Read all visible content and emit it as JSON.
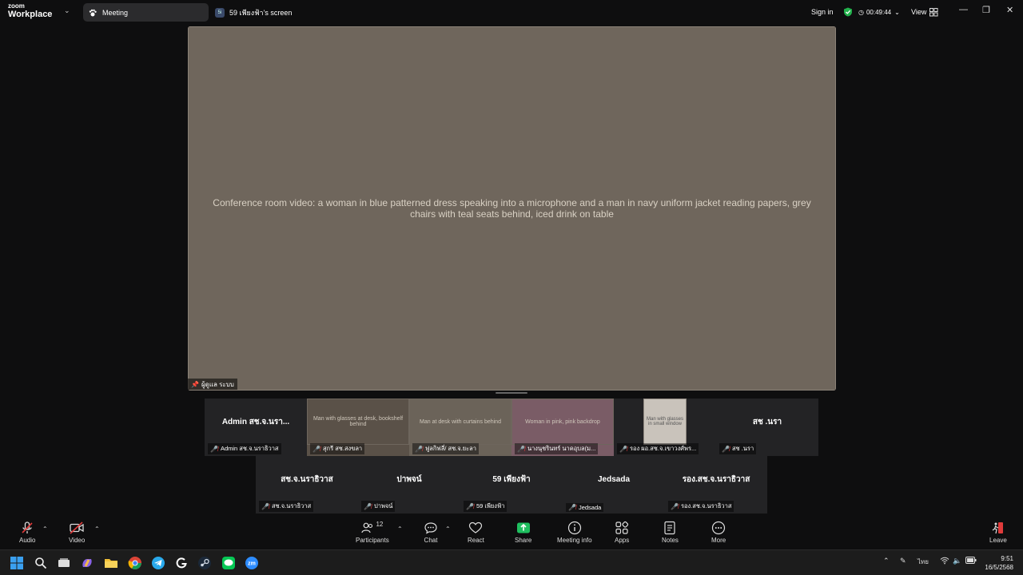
{
  "titlebar": {
    "logo_line1": "zoom",
    "logo_line2": "Workplace",
    "tab_meeting": "Meeting",
    "tab_screen_badge": "5i",
    "tab_screen": "59 เพียงฟ้า's screen",
    "signin": "Sign in",
    "timer": "00:49:44",
    "view": "View"
  },
  "main_video": {
    "description": "Conference room video: a woman in blue patterned dress speaking into a microphone and a man in navy uniform jacket reading papers, grey chairs with teal seats behind, iced drink on table",
    "name_label": "ผู้ดูแล ระบบ"
  },
  "gallery_row1": [
    {
      "display": "Admin สช.จ.นรา...",
      "label": "Admin สช.จ.นราธิวาส",
      "video": false
    },
    {
      "display": "",
      "label": "สุกรี สช.สงขลา",
      "video": true,
      "desc": "Man with glasses at desk, bookshelf behind"
    },
    {
      "display": "",
      "label": "ฟูลกิฟลี่/ สช.จ.ยะลา",
      "video": true,
      "desc": "Man at desk with curtains behind"
    },
    {
      "display": "",
      "label": "นางนุชรินทร์ นาคอุบล(ม...",
      "video": true,
      "desc": "Woman in pink, pink backdrop"
    },
    {
      "display": "",
      "label": "รอง ผอ.สช.จ.เขาวงศ์พร...",
      "video": true,
      "desc": "Man with glasses in small window"
    },
    {
      "display": "สช .นรา",
      "label": "สช .นรา",
      "video": false
    }
  ],
  "gallery_row2": [
    {
      "display": "สช.จ.นราธิวาส",
      "label": "สช.จ.นราธิวาส"
    },
    {
      "display": "ปาพจน์",
      "label": "ปาพจน์"
    },
    {
      "display": "59 เพียงฟ้า",
      "label": "59 เพียงฟ้า"
    },
    {
      "display": "Jedsada",
      "label": "Jedsada"
    },
    {
      "display": "รอง.สช.จ.นราธิวาส",
      "label": "รอง.สช.จ.นราธิวาส"
    }
  ],
  "toolbar": {
    "audio": "Audio",
    "video": "Video",
    "participants": "Participants",
    "participants_count": "12",
    "chat": "Chat",
    "react": "React",
    "share": "Share",
    "meeting_info": "Meeting info",
    "apps": "Apps",
    "notes": "Notes",
    "more": "More",
    "leave": "Leave"
  },
  "taskbar": {
    "lang": "ไทย",
    "time": "9:51",
    "date": "16/5/2568",
    "icons": [
      "windows-start-icon",
      "search-icon",
      "task-view-icon",
      "copilot-icon",
      "file-explorer-icon",
      "chrome-icon",
      "telegram-icon",
      "g-app-icon",
      "steam-icon",
      "line-icon",
      "zoom-icon"
    ]
  },
  "colors": {
    "bg": "#0e0e0f",
    "tile": "#232325",
    "share_green": "#1fbf5f",
    "muted_red": "#e03b3b",
    "shield_green": "#22b14c"
  }
}
